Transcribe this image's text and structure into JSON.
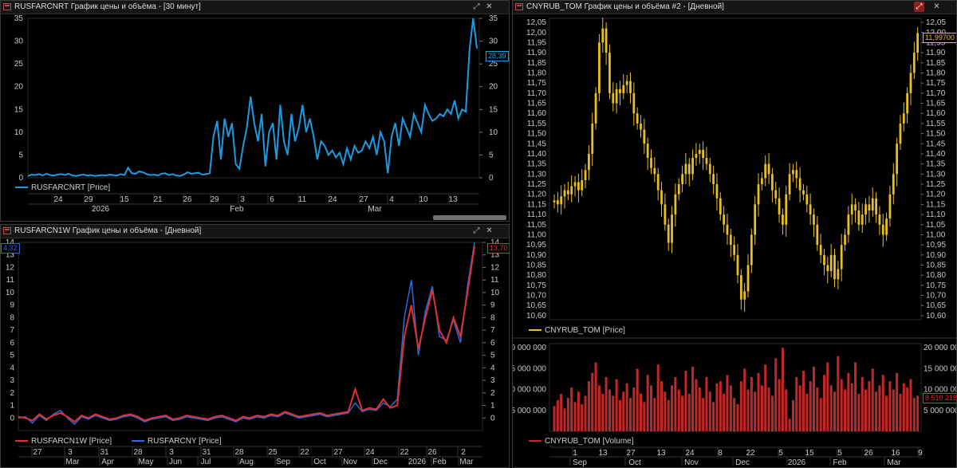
{
  "panels": {
    "top_left": {
      "title": "RUSFARCNRT График цены и объёма - [30 минут]",
      "legend": "RUSFARCNRT [Price]",
      "price_tag": "28,39",
      "color": "#1e9be0"
    },
    "bottom_left": {
      "title": "RUSFARCN1W График цены и объёма - [Дневной]",
      "legend_1": "RUSFARCN1W [Price]",
      "legend_2": "RUSFARCNY [Price]",
      "price_tag_left": "4,32",
      "price_tag_right": "13,70",
      "color_1": "#e03030",
      "color_2": "#2a6ad8"
    },
    "right": {
      "title": "CNYRUB_TOM График цены и объёма #2 - [Дневной]",
      "legend_price": "CNYRUB_TOM [Price]",
      "legend_volume": "CNYRUB_TOM [Volume]",
      "price_tag": "11,99700",
      "volume_tag": "8 510 218",
      "color_price": "#e8c020",
      "color_volume": "#c02828"
    }
  },
  "icons": {
    "restore": "restore-icon",
    "close": "close-icon",
    "window": "window-icon"
  },
  "chart_data": [
    {
      "id": "rusfarcnrt",
      "type": "line",
      "legend": [
        "RUSFARCNRT [Price]"
      ],
      "y_ticks": [
        0,
        5,
        10,
        15,
        20,
        25,
        30,
        35
      ],
      "ylim": [
        0,
        35
      ],
      "x_tick_labels": [
        "24",
        "29",
        "15",
        "21",
        "26",
        "29",
        "3",
        "6",
        "11",
        "24",
        "27",
        "4",
        "10",
        "13"
      ],
      "x_period_labels": [
        "2026",
        "Feb",
        "Mar"
      ],
      "last_value": 28.39,
      "series": [
        {
          "name": "RUSFARCNRT [Price]",
          "values": [
            0.4,
            0.7,
            0.6,
            0.8,
            0.5,
            0.9,
            0.6,
            0.5,
            0.7,
            0.8,
            0.6,
            0.9,
            0.5,
            0.4,
            0.6,
            0.7,
            0.5,
            0.6,
            0.4,
            0.5,
            0.6,
            0.5,
            0.7,
            0.6,
            0.5,
            0.8,
            0.6,
            2.2,
            1.0,
            0.9,
            1.4,
            1.2,
            0.8,
            0.6,
            0.7,
            0.5,
            0.9,
            1.0,
            0.6,
            0.8,
            0.5,
            0.4,
            0.7,
            1.2,
            0.9,
            1.0,
            1.1,
            0.7,
            0.8,
            1.0,
            9.0,
            12.5,
            4.0,
            13.0,
            9.0,
            12.0,
            3.0,
            2.0,
            7.0,
            11.0,
            17.8,
            12.0,
            8.0,
            14.0,
            2.5,
            10.0,
            12.0,
            4.0,
            16.0,
            8.0,
            5.0,
            14.0,
            8.0,
            11.0,
            16.0,
            10.0,
            13.0,
            9.0,
            4.0,
            8.0,
            7.0,
            5.0,
            6.0,
            4.5,
            5.5,
            3.0,
            6.5,
            4.0,
            7.0,
            5.5,
            6.0,
            8.0,
            6.5,
            9.0,
            5.0,
            10.0,
            8.0,
            1.0,
            9.0,
            12.0,
            7.0,
            13.0,
            11.0,
            9.0,
            14.0,
            12.0,
            10.0,
            16.0,
            14.0,
            12.5,
            13.0,
            14.0,
            13.5,
            15.0,
            14.0,
            17.0,
            13.0,
            15.0,
            14.5,
            28.0,
            35.0,
            28.39
          ]
        }
      ]
    },
    {
      "id": "rusfarcn1w",
      "type": "line",
      "legend": [
        "RUSFARCN1W [Price]",
        "RUSFARCNY [Price]"
      ],
      "y_ticks": [
        0,
        1,
        2,
        3,
        4,
        5,
        6,
        7,
        8,
        9,
        10,
        11,
        12,
        13,
        14
      ],
      "ylim": [
        -1,
        14
      ],
      "x_tick_labels": [
        "27",
        "3",
        "31",
        "28",
        "3",
        "31",
        "28",
        "25",
        "22",
        "27",
        "24",
        "22",
        "26",
        "2"
      ],
      "x_period_labels": [
        "Mar",
        "Apr",
        "May",
        "Jun",
        "Jul",
        "Aug",
        "Sep",
        "Oct",
        "Nov",
        "Dec",
        "2026",
        "Feb",
        "Mar"
      ],
      "series": [
        {
          "name": "RUSFARCN1W [Price]",
          "values": [
            0.1,
            0.0,
            -0.2,
            0.3,
            -0.1,
            0.2,
            0.4,
            0.1,
            -0.3,
            0.2,
            0.0,
            0.3,
            0.1,
            -0.1,
            0.0,
            0.2,
            0.3,
            0.1,
            -0.2,
            0.0,
            0.1,
            0.2,
            -0.1,
            0.0,
            0.2,
            0.1,
            0.0,
            -0.1,
            0.1,
            0.2,
            0.0,
            -0.2,
            0.1,
            0.0,
            0.2,
            0.1,
            0.3,
            0.2,
            0.5,
            0.3,
            0.1,
            0.2,
            0.3,
            0.4,
            0.2,
            0.3,
            0.4,
            0.5,
            2.3,
            0.6,
            0.8,
            0.7,
            1.5,
            0.8,
            1.0,
            6.5,
            9.0,
            5.5,
            8.0,
            10.2,
            7.0,
            6.0,
            8.0,
            6.5,
            10.0,
            13.7
          ]
        },
        {
          "name": "RUSFARCNY [Price]",
          "values": [
            0.0,
            0.1,
            -0.4,
            0.2,
            -0.2,
            0.3,
            0.6,
            0.0,
            -0.5,
            0.1,
            -0.1,
            0.2,
            0.0,
            -0.2,
            -0.1,
            0.1,
            0.2,
            0.0,
            -0.3,
            -0.1,
            0.0,
            0.1,
            -0.2,
            -0.1,
            0.1,
            0.0,
            -0.1,
            -0.2,
            0.0,
            0.1,
            -0.1,
            -0.3,
            0.0,
            -0.1,
            0.1,
            0.0,
            0.2,
            0.1,
            0.4,
            0.2,
            0.0,
            0.1,
            0.2,
            0.3,
            0.1,
            0.2,
            0.3,
            0.4,
            1.2,
            0.5,
            0.7,
            0.6,
            1.2,
            0.9,
            1.5,
            8.0,
            11.0,
            5.0,
            8.5,
            10.5,
            6.5,
            6.2,
            7.8,
            6.0,
            10.5,
            14.0
          ]
        }
      ]
    },
    {
      "id": "cnyrub_tom_price",
      "type": "bar",
      "legend": [
        "CNYRUB_TOM [Price]"
      ],
      "y_ticks": [
        "12,05",
        "12,00",
        "11,95",
        "11,90",
        "11,85",
        "11,80",
        "11,75",
        "11,70",
        "11,65",
        "11,60",
        "11,55",
        "11,50",
        "11,45",
        "11,40",
        "11,35",
        "11,30",
        "11,25",
        "11,20",
        "11,15",
        "11,10",
        "11,05",
        "11,00",
        "10,95",
        "10,90",
        "10,85",
        "10,80",
        "10,75",
        "10,70",
        "10,65",
        "10,60"
      ],
      "ylim": [
        10.58,
        12.07
      ],
      "x_tick_labels": [
        "1",
        "13",
        "27",
        "13",
        "24",
        "8",
        "22",
        "5",
        "15",
        "5",
        "26",
        "16",
        "9"
      ],
      "x_period_labels": [
        "Sep",
        "Oct",
        "Nov",
        "Dec",
        "2026",
        "Feb",
        "Mar"
      ],
      "last_value": 11.997,
      "series": [
        {
          "name": "CNYRUB_TOM [Price]",
          "values": [
            11.17,
            11.15,
            11.19,
            11.22,
            11.2,
            11.24,
            11.26,
            11.22,
            11.27,
            11.32,
            11.4,
            11.55,
            11.7,
            11.95,
            12.02,
            11.9,
            11.7,
            11.65,
            11.72,
            11.7,
            11.74,
            11.76,
            11.7,
            11.6,
            11.55,
            11.52,
            11.45,
            11.38,
            11.33,
            11.3,
            11.22,
            11.15,
            11.05,
            10.96,
            11.1,
            11.2,
            11.25,
            11.3,
            11.35,
            11.3,
            11.38,
            11.4,
            11.42,
            11.38,
            11.35,
            11.3,
            11.25,
            11.18,
            11.1,
            11.05,
            11.0,
            10.95,
            10.9,
            10.8,
            10.68,
            10.72,
            10.85,
            11.0,
            11.15,
            11.25,
            11.28,
            11.35,
            11.3,
            11.22,
            11.18,
            11.1,
            11.05,
            11.2,
            11.3,
            11.32,
            11.28,
            11.22,
            11.2,
            11.15,
            11.1,
            11.05,
            10.95,
            10.9,
            10.85,
            10.82,
            10.9,
            10.78,
            10.83,
            10.95,
            11.0,
            11.1,
            11.15,
            11.12,
            11.05,
            11.1,
            11.15,
            11.12,
            11.18,
            11.1,
            11.05,
            11.0,
            11.08,
            11.2,
            11.3,
            11.45,
            11.55,
            11.6,
            11.7,
            11.8,
            11.9,
            11.997
          ]
        }
      ]
    },
    {
      "id": "cnyrub_tom_volume",
      "type": "bar",
      "legend": [
        "CNYRUB_TOM [Volume]"
      ],
      "y_ticks_left": [
        "0 000 000",
        "5 000 000",
        "0 000 000",
        "5 000 000"
      ],
      "y_ticks_right": [
        "20 000 000",
        "15 000 000",
        "10 000 000",
        "5 000 000"
      ],
      "ylim": [
        0,
        21000000
      ],
      "last_value": 8510218,
      "series": [
        {
          "name": "CNYRUB_TOM [Volume]",
          "values": [
            6000000,
            7500000,
            9000000,
            5500000,
            8000000,
            10500000,
            7000000,
            9500000,
            6500000,
            8500000,
            12000000,
            14000000,
            16500000,
            11000000,
            9000000,
            13000000,
            10000000,
            8500000,
            12500000,
            7500000,
            9500000,
            11500000,
            8000000,
            10500000,
            15000000,
            9000000,
            7000000,
            13500000,
            11000000,
            8000000,
            16000000,
            12000000,
            9500000,
            7500000,
            11000000,
            13000000,
            10000000,
            8500000,
            14500000,
            9000000,
            15500000,
            12500000,
            10500000,
            8000000,
            13000000,
            9500000,
            7000000,
            11500000,
            12000000,
            9000000,
            13500000,
            11000000,
            8000000,
            6500000,
            12000000,
            15000000,
            10000000,
            13000000,
            9500000,
            14000000,
            11000000,
            16000000,
            10500000,
            8500000,
            17500000,
            12500000,
            20000000,
            10000000,
            3000000,
            7500000,
            13000000,
            11000000,
            14500000,
            9000000,
            12000000,
            15500000,
            10500000,
            8000000,
            13500000,
            16500000,
            11000000,
            9500000,
            18000000,
            12500000,
            10000000,
            14000000,
            11500000,
            16500000,
            9000000,
            13000000,
            10000000,
            12000000,
            15000000,
            9500000,
            11000000,
            13500000,
            8500000,
            12000000,
            10000000,
            14000000,
            9000000,
            11500000,
            10500000,
            12500000,
            8000000,
            8510218
          ]
        }
      ]
    }
  ]
}
